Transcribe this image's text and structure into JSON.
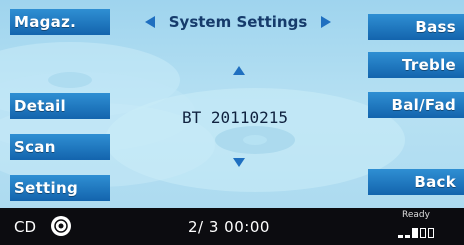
{
  "header": {
    "title": "System Settings",
    "left_arrow_icon": "triangle-left",
    "right_arrow_icon": "triangle-right"
  },
  "left_buttons": {
    "magaz": "Magaz.",
    "detail": "Detail",
    "scan": "Scan",
    "setting": "Setting"
  },
  "right_buttons": {
    "bass": "Bass",
    "treble": "Treble",
    "balfad": "Bal/Fad",
    "back": "Back"
  },
  "main": {
    "display_text": "BT 20110215",
    "up_icon": "triangle-up",
    "down_icon": "triangle-down"
  },
  "status": {
    "source": "CD",
    "disc_icon": "disc-icon",
    "track_time": "2/ 3 00:00",
    "ready": "Ready",
    "signal_icon": "signal-bars-icon"
  },
  "colors": {
    "button_blue": "#1b76c2",
    "screen_bg": "#a9d8ef",
    "status_bar": "#0c0c10",
    "arrow_blue": "#1f6fc0"
  }
}
